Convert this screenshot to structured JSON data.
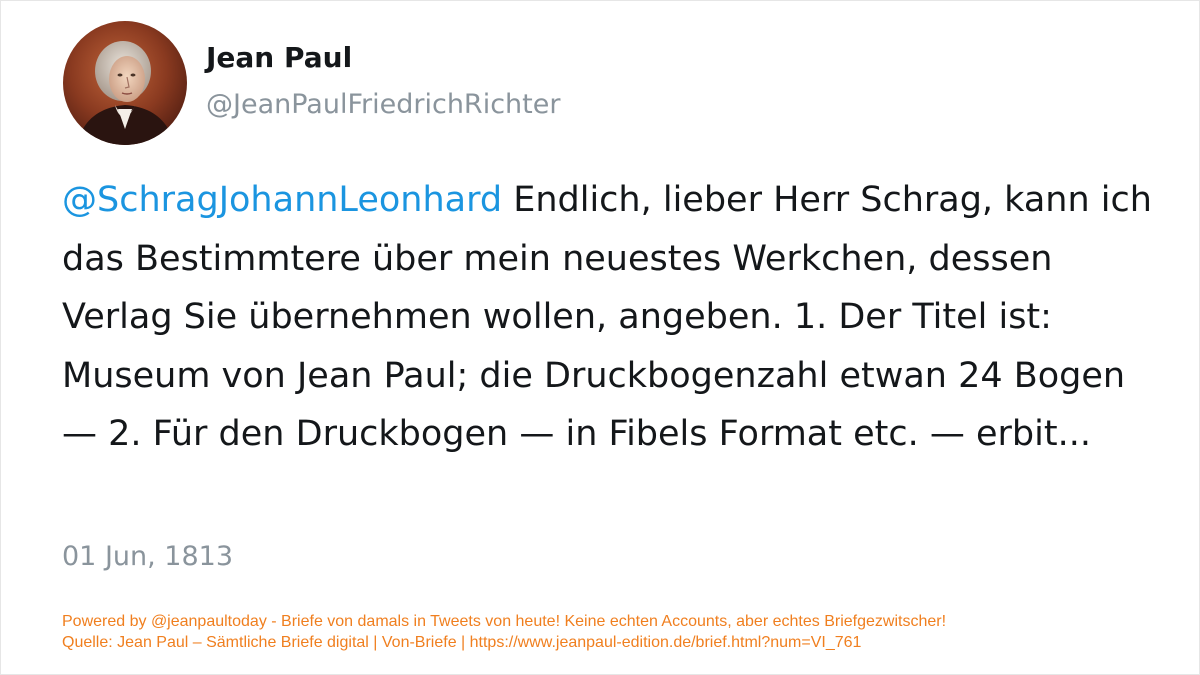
{
  "profile": {
    "name": "Jean Paul",
    "handle": "@JeanPaulFriedrichRichter"
  },
  "tweet": {
    "mention": "@SchragJohannLeonhard",
    "text": " Endlich, lieber Herr Schrag, kann ich das Bestimmtere über mein neuestes Werkchen, dessen Verlag Sie übernehmen wollen, angeben. 1. Der Titel ist: Museum von Jean Paul; die Druckbogenzahl etwan 24 Bogen — 2. Für den Druckbogen — in Fibels Format etc. — erbit...",
    "date": "01 Jun, 1813"
  },
  "footer": {
    "line1": "Powered by @jeanpaultoday - Briefe von damals in Tweets von heute! Keine echten Accounts, aber echtes Briefgezwitscher!",
    "line2": "Quelle: Jean Paul – Sämtliche Briefe digital | Von-Briefe | https://www.jeanpaul-edition.de/brief.html?num=VI_761"
  },
  "colors": {
    "mention": "#1b95e0",
    "muted": "#8a949c",
    "footer": "#f07f1f"
  }
}
